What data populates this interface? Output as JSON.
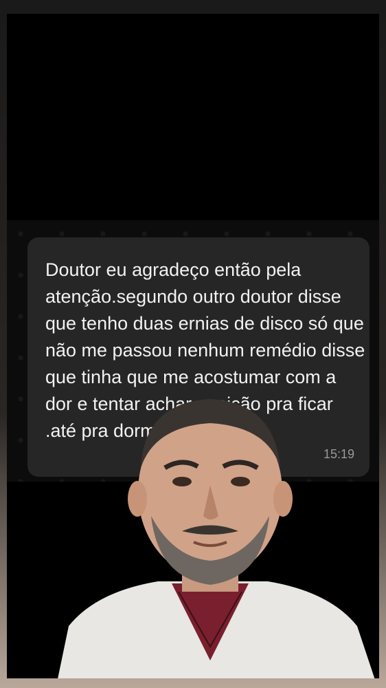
{
  "message": {
    "text": "Doutor eu agradeço então pela atenção.segundo outro doutor disse que tenho duas ernias de disco só que não me passou nenhum remédio disse que tinha que me acostumar com a dor e tentar achar posição pra ficar .até pra dormir tá",
    "time": "15:19"
  },
  "colors": {
    "bubble": "#262626",
    "text": "#f2f2f2",
    "time": "#9a9a9a",
    "background": "#000000"
  }
}
